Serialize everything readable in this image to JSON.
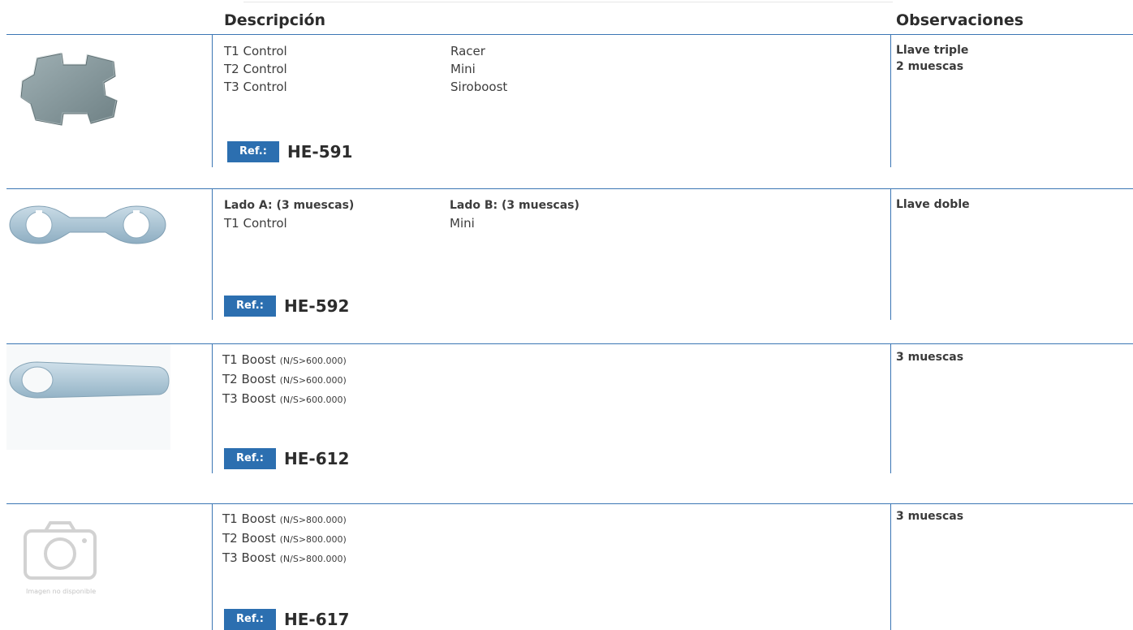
{
  "header": {
    "description": "Descripción",
    "observations": "Observaciones"
  },
  "items": [
    {
      "ref_label": "Ref.:",
      "ref": "HE-591",
      "col1": [
        "T1 Control",
        "T2 Control",
        "T3 Control"
      ],
      "col2": [
        "Racer",
        "Mini",
        "Siroboost"
      ],
      "obs": [
        "Llave triple",
        "2 muescas"
      ]
    },
    {
      "ref_label": "Ref.:",
      "ref": "HE-592",
      "col1_title": "Lado A: (3 muescas)",
      "col1": [
        "T1 Control"
      ],
      "col2_title": "Lado B: (3 muescas)",
      "col2": [
        "Mini"
      ],
      "obs": [
        "Llave doble"
      ]
    },
    {
      "ref_label": "Ref.:",
      "ref": "HE-612",
      "lines": [
        {
          "main": "T1 Boost",
          "note": "(N/S>600.000)"
        },
        {
          "main": "T2 Boost",
          "note": "(N/S>600.000)"
        },
        {
          "main": "T3 Boost",
          "note": "(N/S>600.000)"
        }
      ],
      "obs": [
        "3 muescas"
      ]
    },
    {
      "ref_label": "Ref.:",
      "ref": "HE-617",
      "image_caption": "Imagen no disponible",
      "lines": [
        {
          "main": "T1 Boost",
          "note": "(N/S>800.000)"
        },
        {
          "main": "T2 Boost",
          "note": "(N/S>800.000)"
        },
        {
          "main": "T3 Boost",
          "note": "(N/S>800.000)"
        }
      ],
      "obs": [
        "3 muescas"
      ]
    }
  ]
}
